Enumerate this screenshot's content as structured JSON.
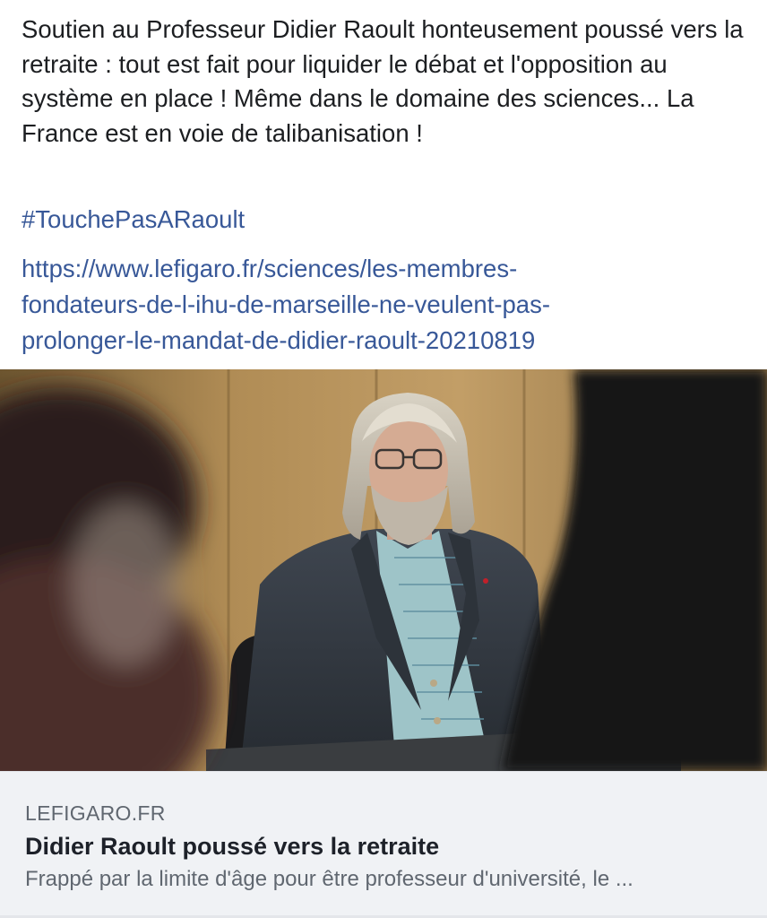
{
  "post": {
    "text": "Soutien au Professeur Didier Raoult honteusement poussé vers la retraite : tout est fait pour liquider le débat et l'opposition au système en place ! Même dans le domaine des sciences... La France est en voie de talibanisation !",
    "hashtag": "#TouchePasARaoult",
    "link_lines": [
      "https://www.lefigaro.fr/sciences/les-membres-",
      "fondateurs-de-l-ihu-de-marseille-ne-veulent-pas-",
      "prolonger-le-mandat-de-didier-raoult-20210819"
    ]
  },
  "card": {
    "domain": "LEFIGARO.FR",
    "title": "Didier Raoult poussé vers la retraite",
    "description": "Frappé par la limite d'âge pour être professeur d'université, le ..."
  },
  "colors": {
    "text": "#1c1e21",
    "link": "#385898",
    "card_bg": "#f0f2f5",
    "muted": "#606770"
  }
}
